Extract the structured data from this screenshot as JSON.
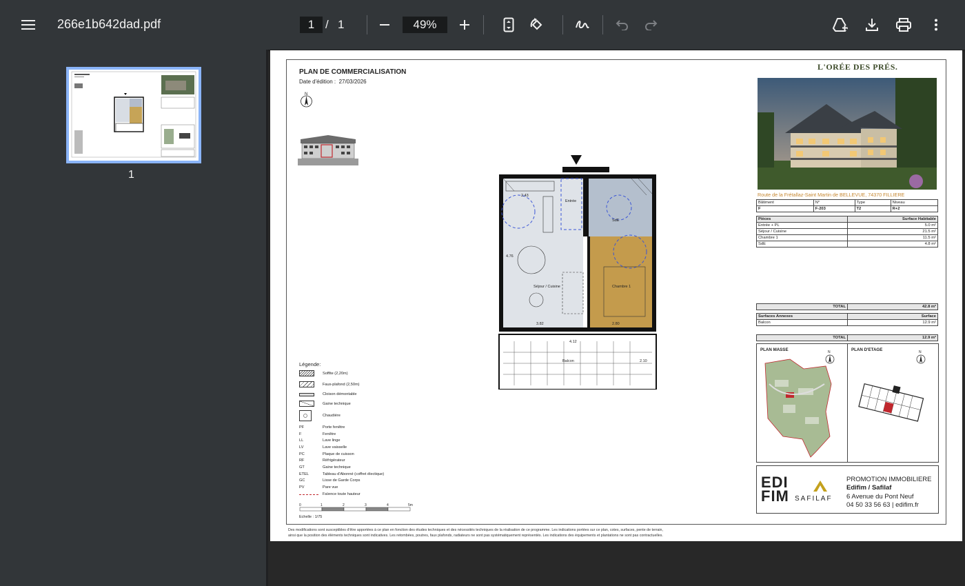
{
  "toolbar": {
    "title": "266e1b642dad.pdf",
    "page_current": "1",
    "page_separator": "/",
    "page_total": "1",
    "zoom": "49%",
    "icons": [
      "menu-icon",
      "zoom-out-icon",
      "zoom-in-icon",
      "fit-page-icon",
      "rotate-icon",
      "annotate-icon",
      "undo-icon",
      "redo-icon",
      "save-to-drive-icon",
      "download-icon",
      "print-icon",
      "more-icon"
    ]
  },
  "sidebar": {
    "thumbnail_label": "1"
  },
  "doc": {
    "title": "PLAN DE COMMERCIALISATION",
    "date_label": "Date d'édition :",
    "date_value": "27/03/2026",
    "brand": "L'ORÉE DES PRÉS.",
    "address": "Route de la Frétallaz-Saint Martin de BELLEVUE, 74370 FILLIERE",
    "info_headers": [
      "Bâtiment",
      "N°",
      "Type",
      "Niveau"
    ],
    "info_values": [
      "F",
      "F-203",
      "T2",
      "R+2"
    ],
    "rooms_header": [
      "Pièces",
      "Surface Habitable"
    ],
    "rooms": [
      {
        "name": "Entrée + PL",
        "area": "5.0 m²"
      },
      {
        "name": "Séjour / Cuisine",
        "area": "21.5 m²"
      },
      {
        "name": "Chambre 1",
        "area": "11.5 m²"
      },
      {
        "name": "SdE",
        "area": "4.8 m²"
      }
    ],
    "total_label": "TOTAL",
    "total_habitable": "42.8 m²",
    "annex_header": [
      "Surfaces Annexes",
      "Surface"
    ],
    "annex_rows": [
      {
        "name": "Balcon",
        "area": "12.9 m²"
      }
    ],
    "total_annex": "12.9 m²",
    "plan_masse": "PLAN MASSE",
    "plan_etage": "PLAN D'ETAGE",
    "north": "N",
    "promo": {
      "line1": "PROMOTION IMMOBILIERE",
      "line2": "Edifim / Safilaf",
      "line3": "6 Avenue du Pont Neuf",
      "line4": "04 50 33 56 63 | edifim.fr",
      "logo1_a": "EDI",
      "logo1_b": "FIM",
      "logo2": "SAFILAF"
    },
    "floor_labels": {
      "entree": "Entrée",
      "sejour": "Séjour / Cuisine",
      "chambre": "Chambre 1",
      "sde": "SdE",
      "balcon": "Balcon",
      "dim1": "3.82",
      "dim2": "2.80",
      "dim3": "4.12",
      "dim4": "4.76",
      "dim5": "2.43",
      "dim6": "2.10"
    },
    "legend_title": "Légende:",
    "legend_swatches": [
      {
        "label": "Soffite (2,20m)"
      },
      {
        "label": "Faux-plafond (2,50m)"
      },
      {
        "label": "Cloison démontable"
      },
      {
        "label": "Gaine technique"
      },
      {
        "label": "Chaudière"
      }
    ],
    "legend_codes": [
      {
        "code": "PF",
        "label": "Porte fenêtre"
      },
      {
        "code": "F",
        "label": "Fenêtre"
      },
      {
        "code": "LL",
        "label": "Lave linge"
      },
      {
        "code": "LV",
        "label": "Lave vaisselle"
      },
      {
        "code": "PC",
        "label": "Plaque de cuisson"
      },
      {
        "code": "RF",
        "label": "Réfrigérateur"
      },
      {
        "code": "GT",
        "label": "Gaine technique"
      },
      {
        "code": "ETEL",
        "label": "Tableau d'Abonné (coffret électique)"
      },
      {
        "code": "GC",
        "label": "Lisse de Garde Corps"
      },
      {
        "code": "PV",
        "label": "Pare vue"
      },
      {
        "code": "",
        "label": "Faïence toute hauteur"
      }
    ],
    "scale_ticks": [
      "0",
      "1",
      "2",
      "3",
      "4",
      "5m"
    ],
    "scale_label": "Echelle : 1/75",
    "disclaimer_1": "Des modifications sont susceptibles d'être apportées à ce plan en fonction des études techniques et des nécessités techniques de la réalisation de ce programme.  Les indications portées sur ce plan, cotes, surfaces, pente de terrain,",
    "disclaimer_2": "ainsi que la position des éléments techniques sont indicatives.  Les retombées, poutres, faux plafonds, radiateurs ne sont pas systématiquement représentés. Les indications des équipements et plantations ne sont pas contractuelles."
  }
}
